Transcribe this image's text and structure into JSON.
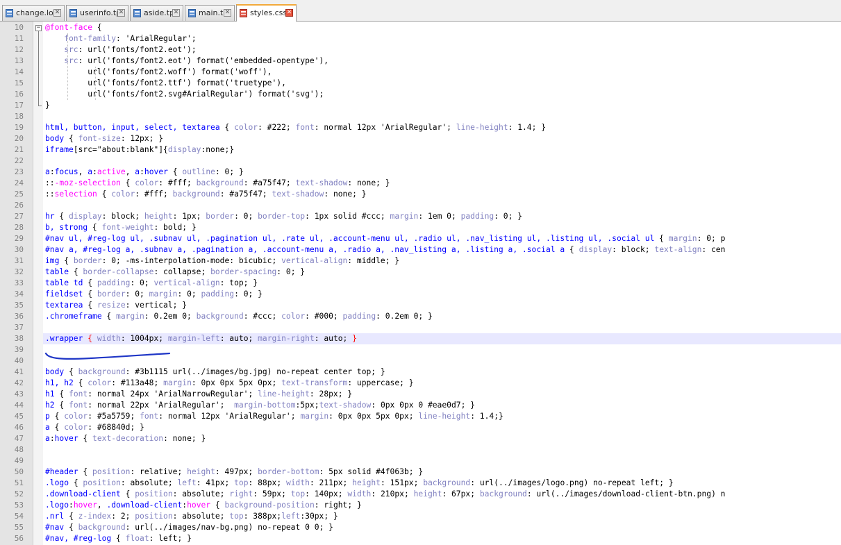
{
  "tabs": [
    {
      "label": "change.log",
      "active": false
    },
    {
      "label": "userinfo.tpl",
      "active": false
    },
    {
      "label": "aside.tpl",
      "active": false
    },
    {
      "label": "main.tpl",
      "active": false
    },
    {
      "label": "styles.css",
      "active": true
    }
  ],
  "tab_close_glyph": "✕",
  "highlighted_line": 38,
  "annotation_color": "#1f36c6",
  "code_lines": [
    {
      "n": "10",
      "tokens": [
        [
          "@font-face",
          "pc"
        ],
        [
          " {",
          "pun"
        ]
      ]
    },
    {
      "n": "11",
      "tokens": [
        [
          "    font-family",
          "prop"
        ],
        [
          ": 'ArialRegular';",
          "val"
        ]
      ]
    },
    {
      "n": "12",
      "tokens": [
        [
          "    src",
          "prop"
        ],
        [
          ": url('fonts/font2.eot');",
          "val"
        ]
      ]
    },
    {
      "n": "13",
      "tokens": [
        [
          "    src",
          "prop"
        ],
        [
          ": url('fonts/font2.eot') format('embedded-opentype'),",
          "val"
        ]
      ]
    },
    {
      "n": "14",
      "tokens": [
        [
          "         url('fonts/font2.woff') format('woff'),",
          "val"
        ]
      ]
    },
    {
      "n": "15",
      "tokens": [
        [
          "         url('fonts/font2.ttf') format('truetype'),",
          "val"
        ]
      ]
    },
    {
      "n": "16",
      "tokens": [
        [
          "         url('fonts/font2.svg#ArialRegular') format('svg');",
          "val"
        ]
      ]
    },
    {
      "n": "17",
      "tokens": [
        [
          "}",
          "pun"
        ]
      ]
    },
    {
      "n": "18",
      "tokens": []
    },
    {
      "n": "19",
      "tokens": [
        [
          "html, button, input, select, textarea",
          "sel"
        ],
        [
          " { ",
          "pun"
        ],
        [
          "color",
          "prop"
        ],
        [
          ": #222; ",
          "val"
        ],
        [
          "font",
          "prop"
        ],
        [
          ": normal 12px 'ArialRegular'; ",
          "val"
        ],
        [
          "line-height",
          "prop"
        ],
        [
          ": 1.4; }",
          "val"
        ]
      ]
    },
    {
      "n": "20",
      "tokens": [
        [
          "body",
          "sel"
        ],
        [
          " { ",
          "pun"
        ],
        [
          "font-size",
          "prop"
        ],
        [
          ": 12px; }",
          "val"
        ]
      ]
    },
    {
      "n": "21",
      "tokens": [
        [
          "iframe",
          "sel"
        ],
        [
          "[src=\"about:blank\"]{",
          "val"
        ],
        [
          "display",
          "prop"
        ],
        [
          ":none;}",
          "val"
        ]
      ]
    },
    {
      "n": "22",
      "tokens": []
    },
    {
      "n": "23",
      "tokens": [
        [
          "a",
          "sel"
        ],
        [
          ":",
          "pun"
        ],
        [
          "focus",
          "sel"
        ],
        [
          ", ",
          "pun"
        ],
        [
          "a",
          "sel"
        ],
        [
          ":",
          "pun"
        ],
        [
          "active",
          "pc"
        ],
        [
          ", ",
          "pun"
        ],
        [
          "a",
          "sel"
        ],
        [
          ":",
          "pun"
        ],
        [
          "hover",
          "sel"
        ],
        [
          " { ",
          "pun"
        ],
        [
          "outline",
          "prop"
        ],
        [
          ": 0; }",
          "val"
        ]
      ]
    },
    {
      "n": "24",
      "tokens": [
        [
          "::",
          "pun"
        ],
        [
          "-moz-selection",
          "pc"
        ],
        [
          " { ",
          "pun"
        ],
        [
          "color",
          "prop"
        ],
        [
          ": #fff; ",
          "val"
        ],
        [
          "background",
          "prop"
        ],
        [
          ": #a75f47; ",
          "val"
        ],
        [
          "text-shadow",
          "prop"
        ],
        [
          ": none; }",
          "val"
        ]
      ]
    },
    {
      "n": "25",
      "tokens": [
        [
          "::",
          "pun"
        ],
        [
          "selection",
          "pc"
        ],
        [
          " { ",
          "pun"
        ],
        [
          "color",
          "prop"
        ],
        [
          ": #fff; ",
          "val"
        ],
        [
          "background",
          "prop"
        ],
        [
          ": #a75f47; ",
          "val"
        ],
        [
          "text-shadow",
          "prop"
        ],
        [
          ": none; }",
          "val"
        ]
      ]
    },
    {
      "n": "26",
      "tokens": []
    },
    {
      "n": "27",
      "tokens": [
        [
          "hr",
          "sel"
        ],
        [
          " { ",
          "pun"
        ],
        [
          "display",
          "prop"
        ],
        [
          ": block; ",
          "val"
        ],
        [
          "height",
          "prop"
        ],
        [
          ": 1px; ",
          "val"
        ],
        [
          "border",
          "prop"
        ],
        [
          ": 0; ",
          "val"
        ],
        [
          "border-top",
          "prop"
        ],
        [
          ": 1px solid #ccc; ",
          "val"
        ],
        [
          "margin",
          "prop"
        ],
        [
          ": 1em 0; ",
          "val"
        ],
        [
          "padding",
          "prop"
        ],
        [
          ": 0; }",
          "val"
        ]
      ]
    },
    {
      "n": "28",
      "tokens": [
        [
          "b, strong",
          "sel"
        ],
        [
          " { ",
          "pun"
        ],
        [
          "font-weight",
          "prop"
        ],
        [
          ": bold; }",
          "val"
        ]
      ]
    },
    {
      "n": "29",
      "tokens": [
        [
          "#nav ul, #reg-log ul, .subnav ul, .pagination ul, .rate ul, .account-menu ul, .radio ul, .nav_listing ul, .listing ul, .social ul",
          "sel"
        ],
        [
          " { ",
          "pun"
        ],
        [
          "margin",
          "prop"
        ],
        [
          ": 0; p",
          "val"
        ]
      ]
    },
    {
      "n": "30",
      "tokens": [
        [
          "#nav a, #reg-log a, .subnav a, .pagination a, .account-menu a, .radio a, .nav_listing a, .listing a, .social a",
          "sel"
        ],
        [
          " { ",
          "pun"
        ],
        [
          "display",
          "prop"
        ],
        [
          ": block; ",
          "val"
        ],
        [
          "text-align",
          "prop"
        ],
        [
          ": cen",
          "val"
        ]
      ]
    },
    {
      "n": "31",
      "tokens": [
        [
          "img",
          "sel"
        ],
        [
          " { ",
          "pun"
        ],
        [
          "border",
          "prop"
        ],
        [
          ": 0; -ms-interpolation-mode: bicubic; ",
          "val"
        ],
        [
          "vertical-align",
          "prop"
        ],
        [
          ": middle; }",
          "val"
        ]
      ]
    },
    {
      "n": "32",
      "tokens": [
        [
          "table",
          "sel"
        ],
        [
          " { ",
          "pun"
        ],
        [
          "border-collapse",
          "prop"
        ],
        [
          ": collapse; ",
          "val"
        ],
        [
          "border-spacing",
          "prop"
        ],
        [
          ": 0; }",
          "val"
        ]
      ]
    },
    {
      "n": "33",
      "tokens": [
        [
          "table td",
          "sel"
        ],
        [
          " { ",
          "pun"
        ],
        [
          "padding",
          "prop"
        ],
        [
          ": 0; ",
          "val"
        ],
        [
          "vertical-align",
          "prop"
        ],
        [
          ": top; }",
          "val"
        ]
      ]
    },
    {
      "n": "34",
      "tokens": [
        [
          "fieldset",
          "sel"
        ],
        [
          " { ",
          "pun"
        ],
        [
          "border",
          "prop"
        ],
        [
          ": 0; ",
          "val"
        ],
        [
          "margin",
          "prop"
        ],
        [
          ": 0; ",
          "val"
        ],
        [
          "padding",
          "prop"
        ],
        [
          ": 0; }",
          "val"
        ]
      ]
    },
    {
      "n": "35",
      "tokens": [
        [
          "textarea",
          "sel"
        ],
        [
          " { ",
          "pun"
        ],
        [
          "resize",
          "prop"
        ],
        [
          ": vertical; }",
          "val"
        ]
      ]
    },
    {
      "n": "36",
      "tokens": [
        [
          ".chromeframe",
          "sel"
        ],
        [
          " { ",
          "pun"
        ],
        [
          "margin",
          "prop"
        ],
        [
          ": 0.2em 0; ",
          "val"
        ],
        [
          "background",
          "prop"
        ],
        [
          ": #ccc; ",
          "val"
        ],
        [
          "color",
          "prop"
        ],
        [
          ": #000; ",
          "val"
        ],
        [
          "padding",
          "prop"
        ],
        [
          ": 0.2em 0; }",
          "val"
        ]
      ]
    },
    {
      "n": "37",
      "tokens": []
    },
    {
      "n": "38",
      "tokens": [
        [
          ".wrapper",
          "sel"
        ],
        [
          " { ",
          "br"
        ],
        [
          "width",
          "prop"
        ],
        [
          ": 1004px; ",
          "val"
        ],
        [
          "margin-left",
          "prop"
        ],
        [
          ": auto; ",
          "val"
        ],
        [
          "margin-right",
          "prop"
        ],
        [
          ": auto; ",
          "val"
        ],
        [
          "}",
          "br"
        ]
      ]
    },
    {
      "n": "39",
      "tokens": []
    },
    {
      "n": "40",
      "tokens": []
    },
    {
      "n": "41",
      "tokens": [
        [
          "body",
          "sel"
        ],
        [
          " { ",
          "pun"
        ],
        [
          "background",
          "prop"
        ],
        [
          ": #3b1115 url(../images/bg.jpg) no-repeat center top; }",
          "val"
        ]
      ]
    },
    {
      "n": "42",
      "tokens": [
        [
          "h1, h2",
          "sel"
        ],
        [
          " { ",
          "pun"
        ],
        [
          "color",
          "prop"
        ],
        [
          ": #113a48; ",
          "val"
        ],
        [
          "margin",
          "prop"
        ],
        [
          ": 0px 0px 5px 0px; ",
          "val"
        ],
        [
          "text-transform",
          "prop"
        ],
        [
          ": uppercase; }",
          "val"
        ]
      ]
    },
    {
      "n": "43",
      "tokens": [
        [
          "h1",
          "sel"
        ],
        [
          " { ",
          "pun"
        ],
        [
          "font",
          "prop"
        ],
        [
          ": normal 24px 'ArialNarrowRegular'; ",
          "val"
        ],
        [
          "line-height",
          "prop"
        ],
        [
          ": 28px; }",
          "val"
        ]
      ]
    },
    {
      "n": "44",
      "tokens": [
        [
          "h2",
          "sel"
        ],
        [
          " { ",
          "pun"
        ],
        [
          "font",
          "prop"
        ],
        [
          ": normal 22px 'ArialRegular';  ",
          "val"
        ],
        [
          "margin-bottom",
          "prop"
        ],
        [
          ":5px;",
          "val"
        ],
        [
          "text-shadow",
          "prop"
        ],
        [
          ": 0px 0px 0 #eae0d7; }",
          "val"
        ]
      ]
    },
    {
      "n": "45",
      "tokens": [
        [
          "p",
          "sel"
        ],
        [
          " { ",
          "pun"
        ],
        [
          "color",
          "prop"
        ],
        [
          ": #5a5759; ",
          "val"
        ],
        [
          "font",
          "prop"
        ],
        [
          ": normal 12px 'ArialRegular'; ",
          "val"
        ],
        [
          "margin",
          "prop"
        ],
        [
          ": 0px 0px 5px 0px; ",
          "val"
        ],
        [
          "line-height",
          "prop"
        ],
        [
          ": 1.4;}",
          "val"
        ]
      ]
    },
    {
      "n": "46",
      "tokens": [
        [
          "a",
          "sel"
        ],
        [
          " { ",
          "pun"
        ],
        [
          "color",
          "prop"
        ],
        [
          ": #68840d; }",
          "val"
        ]
      ]
    },
    {
      "n": "47",
      "tokens": [
        [
          "a",
          "sel"
        ],
        [
          ":",
          "pun"
        ],
        [
          "hover",
          "sel"
        ],
        [
          " { ",
          "pun"
        ],
        [
          "text-decoration",
          "prop"
        ],
        [
          ": none; }",
          "val"
        ]
      ]
    },
    {
      "n": "48",
      "tokens": []
    },
    {
      "n": "49",
      "tokens": []
    },
    {
      "n": "50",
      "tokens": [
        [
          "#header",
          "sel"
        ],
        [
          " { ",
          "pun"
        ],
        [
          "position",
          "prop"
        ],
        [
          ": relative; ",
          "val"
        ],
        [
          "height",
          "prop"
        ],
        [
          ": 497px; ",
          "val"
        ],
        [
          "border-bottom",
          "prop"
        ],
        [
          ": 5px solid #4f063b; }",
          "val"
        ]
      ]
    },
    {
      "n": "51",
      "tokens": [
        [
          ".logo",
          "sel"
        ],
        [
          " { ",
          "pun"
        ],
        [
          "position",
          "prop"
        ],
        [
          ": absolute; ",
          "val"
        ],
        [
          "left",
          "prop"
        ],
        [
          ": 41px; ",
          "val"
        ],
        [
          "top",
          "prop"
        ],
        [
          ": 88px; ",
          "val"
        ],
        [
          "width",
          "prop"
        ],
        [
          ": 211px; ",
          "val"
        ],
        [
          "height",
          "prop"
        ],
        [
          ": 151px; ",
          "val"
        ],
        [
          "background",
          "prop"
        ],
        [
          ": url(../images/logo.png) no-repeat left; }",
          "val"
        ]
      ]
    },
    {
      "n": "52",
      "tokens": [
        [
          ".download-client",
          "sel"
        ],
        [
          " { ",
          "pun"
        ],
        [
          "position",
          "prop"
        ],
        [
          ": absolute; ",
          "val"
        ],
        [
          "right",
          "prop"
        ],
        [
          ": 59px; ",
          "val"
        ],
        [
          "top",
          "prop"
        ],
        [
          ": 140px; ",
          "val"
        ],
        [
          "width",
          "prop"
        ],
        [
          ": 210px; ",
          "val"
        ],
        [
          "height",
          "prop"
        ],
        [
          ": 67px; ",
          "val"
        ],
        [
          "background",
          "prop"
        ],
        [
          ": url(../images/download-client-btn.png) n",
          "val"
        ]
      ]
    },
    {
      "n": "53",
      "tokens": [
        [
          ".logo",
          "sel"
        ],
        [
          ":",
          "pun"
        ],
        [
          "hover",
          "pc"
        ],
        [
          ", ",
          "pun"
        ],
        [
          ".download-client",
          "sel"
        ],
        [
          ":",
          "pun"
        ],
        [
          "hover",
          "pc"
        ],
        [
          " { ",
          "pun"
        ],
        [
          "background-position",
          "prop"
        ],
        [
          ": right; }",
          "val"
        ]
      ]
    },
    {
      "n": "54",
      "tokens": [
        [
          ".nrl",
          "sel"
        ],
        [
          " { ",
          "pun"
        ],
        [
          "z-index",
          "prop"
        ],
        [
          ": 2; ",
          "val"
        ],
        [
          "position",
          "prop"
        ],
        [
          ": absolute; ",
          "val"
        ],
        [
          "top",
          "prop"
        ],
        [
          ": 388px;",
          "val"
        ],
        [
          "left",
          "prop"
        ],
        [
          ":30px; }",
          "val"
        ]
      ]
    },
    {
      "n": "55",
      "tokens": [
        [
          "#nav",
          "sel"
        ],
        [
          " { ",
          "pun"
        ],
        [
          "background",
          "prop"
        ],
        [
          ": url(../images/nav-bg.png) no-repeat 0 0; }",
          "val"
        ]
      ]
    },
    {
      "n": "56",
      "tokens": [
        [
          "#nav, #reg-log",
          "sel"
        ],
        [
          " { ",
          "pun"
        ],
        [
          "float",
          "prop"
        ],
        [
          ": left; }",
          "val"
        ]
      ]
    }
  ]
}
